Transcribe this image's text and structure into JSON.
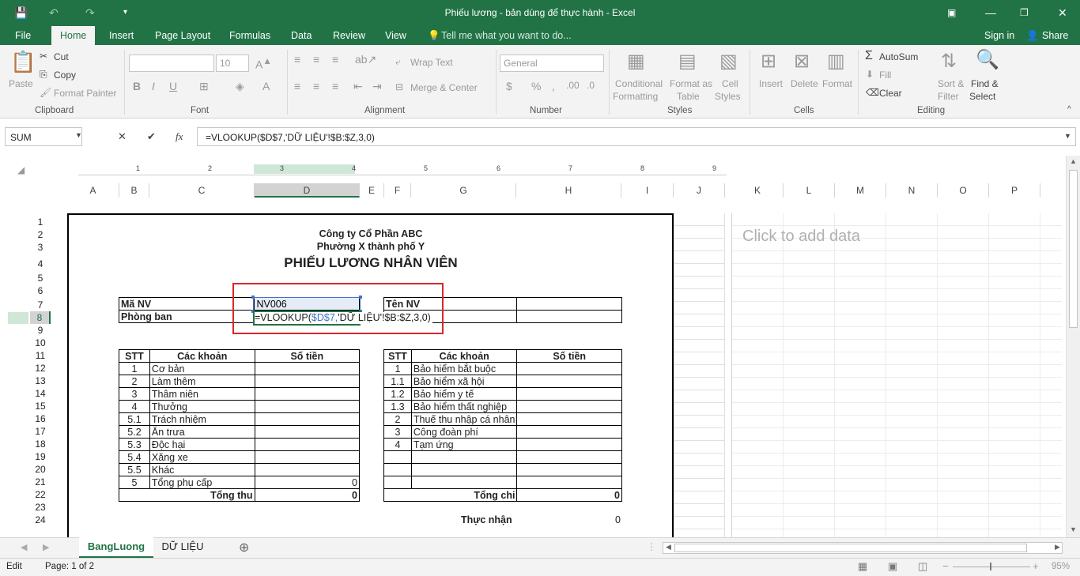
{
  "window": {
    "title": "Phiếu lương - bản dùng để thực hành - Excel"
  },
  "tabs": {
    "file": "File",
    "home": "Home",
    "insert": "Insert",
    "page_layout": "Page Layout",
    "formulas": "Formulas",
    "data": "Data",
    "review": "Review",
    "view": "View",
    "tell": "Tell me what you want to do...",
    "signin": "Sign in",
    "share": "Share"
  },
  "ribbon": {
    "paste": "Paste",
    "cut": "Cut",
    "copy": "Copy",
    "format_painter": "Format Painter",
    "clipboard": "Clipboard",
    "font_size": "10",
    "font": "Font",
    "wrap": "Wrap Text",
    "merge": "Merge & Center",
    "alignment": "Alignment",
    "number_format": "General",
    "number": "Number",
    "cond1": "Conditional",
    "cond2": "Formatting",
    "fmt1": "Format as",
    "fmt2": "Table",
    "cs1": "Cell",
    "cs2": "Styles",
    "styles": "Styles",
    "insert": "Insert",
    "delete": "Delete",
    "format": "Format",
    "cells": "Cells",
    "autosum": "AutoSum",
    "fill": "Fill",
    "clear": "Clear",
    "sort1": "Sort &",
    "sort2": "Filter",
    "find1": "Find &",
    "find2": "Select",
    "editing": "Editing"
  },
  "formula_bar": {
    "name_box": "SUM",
    "fx": "fx",
    "formula": "=VLOOKUP($D$7,'DỮ LIỆU'!$B:$Z,3,0)"
  },
  "ruler": [
    "1",
    "2",
    "3",
    "4",
    "5",
    "6",
    "7",
    "8",
    "9"
  ],
  "columns": [
    "A",
    "B",
    "C",
    "D",
    "E",
    "F",
    "G",
    "H",
    "I",
    "J",
    "K",
    "L",
    "M",
    "N",
    "O",
    "P"
  ],
  "rows": [
    "1",
    "2",
    "3",
    "4",
    "5",
    "6",
    "7",
    "8",
    "9",
    "10",
    "11",
    "12",
    "13",
    "14",
    "15",
    "16",
    "17",
    "18",
    "19",
    "20",
    "21",
    "22",
    "23",
    "24"
  ],
  "sheet": {
    "company": "Công ty Cổ Phần ABC",
    "address": "Phường X thành phố Y",
    "heading": "PHIẾU LƯƠNG NHÂN VIÊN",
    "ma_nv_label": "Mã NV",
    "ma_nv_value": "NV006",
    "phong_ban_label": "Phòng ban",
    "ten_nv_label": "Tên NV",
    "edit_prefix": "=VLOOKUP(",
    "edit_ref": "$D$7,",
    "edit_rest": "'DỮ LIỆU'!$B:$Z,3,0)",
    "left_headers": [
      "STT",
      "Các khoản",
      "Số tiền"
    ],
    "left_rows": [
      [
        "1",
        "Cơ bản",
        ""
      ],
      [
        "2",
        "Làm thêm",
        ""
      ],
      [
        "3",
        "Thâm niên",
        ""
      ],
      [
        "4",
        "Thưởng",
        ""
      ],
      [
        "5.1",
        "Trách nhiệm",
        ""
      ],
      [
        "5.2",
        "Ăn trưa",
        ""
      ],
      [
        "5.3",
        "Độc hại",
        ""
      ],
      [
        "5.4",
        "Xăng xe",
        ""
      ],
      [
        "5.5",
        "Khác",
        ""
      ],
      [
        "5",
        "Tổng phụ cấp",
        "0"
      ]
    ],
    "left_total_label": "Tổng thu",
    "left_total_value": "0",
    "right_headers": [
      "STT",
      "Các khoản",
      "Số tiền"
    ],
    "right_rows": [
      [
        "1",
        "Bảo hiểm bắt buộc",
        ""
      ],
      [
        "1.1",
        "Bảo hiểm xã hội",
        ""
      ],
      [
        "1.2",
        "Bảo hiểm y tế",
        ""
      ],
      [
        "1.3",
        "Bảo hiểm thất nghiệp",
        ""
      ],
      [
        "2",
        "Thuế thu nhập cá nhân",
        ""
      ],
      [
        "3",
        "Công đoàn phí",
        ""
      ],
      [
        "4",
        "Tạm ứng",
        ""
      ],
      [
        "",
        "",
        ""
      ],
      [
        "",
        "",
        ""
      ]
    ],
    "right_total_label": "Tổng chi",
    "right_total_value": "0",
    "net_label": "Thực nhận",
    "net_value": "0",
    "click_to_add": "Click to add data"
  },
  "sheet_tabs": [
    "BangLuong",
    "DỮ LIỆU"
  ],
  "status": {
    "mode": "Edit",
    "page": "Page: 1 of 2",
    "zoom": "95%"
  },
  "colors": {
    "accent": "#217346",
    "highlight": "#d9262c",
    "ref_blue": "#4472c4"
  }
}
